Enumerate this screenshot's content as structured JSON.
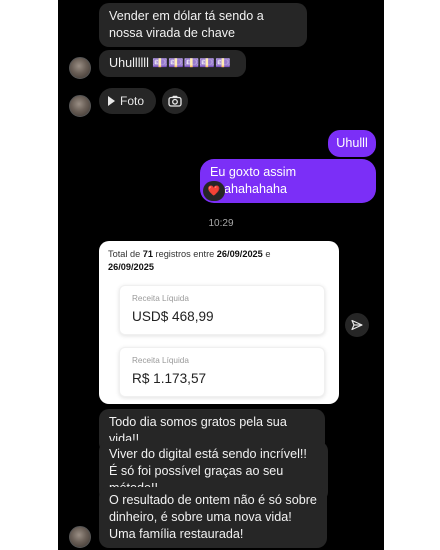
{
  "messages": {
    "m1": "Vender em dólar tá sendo a nossa virada de chave",
    "m2": "Uhullllll 💷💷💷💷💷",
    "photo_label": "Foto",
    "out1": "Uhulll",
    "out2": "Eu goxto assim hhahahahaha",
    "reaction": "❤️",
    "time": "10:29",
    "m3": "Todo dia somos gratos pela sua vida!!",
    "m4": "Viver do digital está sendo incrível!! É só foi possível graças ao seu método!!",
    "m5": "O resultado de ontem não é só sobre dinheiro, é sobre uma nova vida! Uma família restaurada!"
  },
  "card": {
    "summary_prefix": "Total de ",
    "count": "71",
    "summary_mid": " registros entre ",
    "date_start": "26/09/2025",
    "summary_and": " e ",
    "date_end": "26/09/2025",
    "metric1_label": "Receita Líquida",
    "metric1_value": "USD$ 468,99",
    "metric2_label": "Receita Líquida",
    "metric2_value": "R$ 1.173,57"
  },
  "icons": {
    "avatar": "avatar",
    "play": "play-icon",
    "camera": "camera-icon",
    "share": "share-icon",
    "heart": "heart-reaction-icon"
  },
  "colors": {
    "background": "#000000",
    "incoming_bubble": "#262626",
    "outgoing_bubble": "#7b2ff7",
    "card": "#ffffff"
  }
}
